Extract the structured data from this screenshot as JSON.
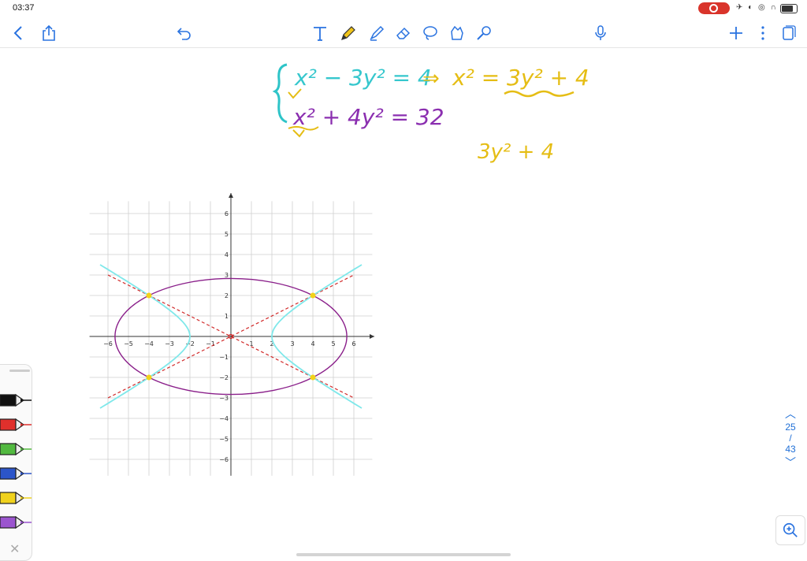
{
  "status_bar": {
    "time": "03:37"
  },
  "toolbar": {
    "left": [
      "back-icon",
      "share-icon"
    ],
    "undo": "undo-icon",
    "tools": [
      "text-tool-icon",
      "pen-tool-icon",
      "highlighter-tool-icon",
      "eraser-tool-icon",
      "lasso-tool-icon",
      "image-tool-icon",
      "laser-pointer-tool-icon"
    ],
    "right": [
      "microphone-icon",
      "add-icon",
      "more-icon",
      "pages-icon"
    ]
  },
  "handwriting": {
    "line1_left": "x² − 3y² = 4",
    "line1_arrow": "⇒",
    "line1_right": "x² = 3y² + 4",
    "line2": "x² + 4y² = 32",
    "side_note": "3y² + 4"
  },
  "chart_data": {
    "type": "line",
    "x_ticks": [
      -6,
      -5,
      -4,
      -3,
      -2,
      -1,
      1,
      2,
      3,
      4,
      5,
      6
    ],
    "y_ticks": [
      -6,
      -5,
      -4,
      -3,
      -2,
      -1,
      1,
      2,
      3,
      4,
      5,
      6
    ],
    "xlim": [
      -7,
      7
    ],
    "ylim": [
      -7,
      7
    ],
    "grid": true,
    "curves": [
      {
        "kind": "ellipse",
        "equation": "x^2 + 4y^2 = 32",
        "color": "#8a1f8a"
      },
      {
        "kind": "hyperbola",
        "equation": "x^2 - 3y^2 = 4",
        "color": "#7fe8ea"
      },
      {
        "kind": "asymptote",
        "slope": 0.5,
        "color": "#d12a2a",
        "dashed": true
      },
      {
        "kind": "asymptote",
        "slope": -0.5,
        "color": "#d12a2a",
        "dashed": true
      }
    ],
    "intersection_points": [
      [
        4,
        2
      ],
      [
        -4,
        2
      ],
      [
        4,
        -2
      ],
      [
        -4,
        -2
      ]
    ],
    "origin_marker": [
      0,
      0
    ]
  },
  "pens": [
    {
      "color": "#111111"
    },
    {
      "color": "#e0302c"
    },
    {
      "color": "#52b940"
    },
    {
      "color": "#2c55c9"
    },
    {
      "color": "#f0d21d"
    },
    {
      "color": "#9b55cf"
    }
  ],
  "pager": {
    "current": "25",
    "sep": "/",
    "total": "43"
  }
}
